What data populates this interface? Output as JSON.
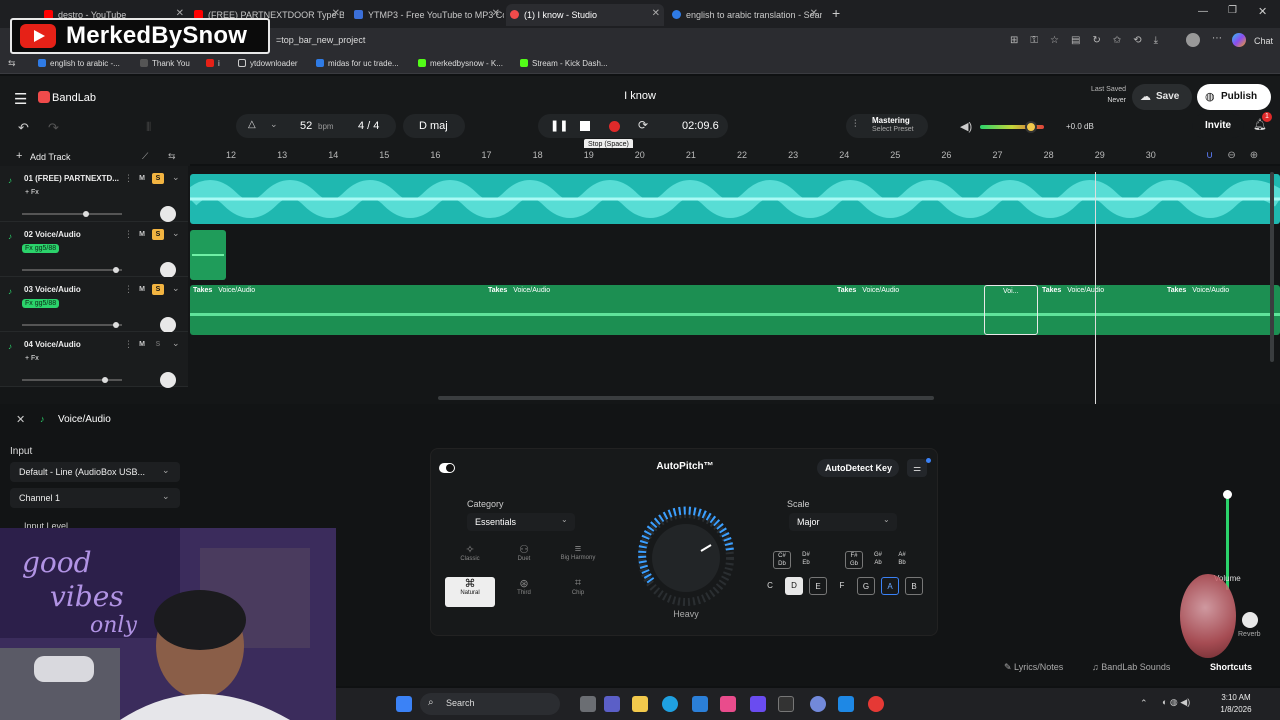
{
  "watermark": "MerkedBySnow",
  "browser": {
    "tabs": [
      {
        "title": "destro - YouTube",
        "color": "#ff0000"
      },
      {
        "title": "(FREE) PARTNEXTDOOR Type Beat",
        "color": "#ff0000"
      },
      {
        "title": "YTMP3 - Free YouTube to MP3 Co",
        "color": "#3b6fd8"
      },
      {
        "title": "(1) I know - Studio",
        "color": "#f04b4b"
      },
      {
        "title": "english to arabic translation - Sear",
        "color": "#2f7be5"
      }
    ],
    "url": "=top_bar_new_project",
    "bookmarks": [
      "english to arabic -...",
      "Thank You",
      "i",
      "ytdownloader",
      "midas for uc trade...",
      "merkedbysnow - K...",
      "Stream - Kick Dash..."
    ],
    "chat_label": "Chat"
  },
  "app": {
    "brand": "BandLab",
    "project_title": "I know",
    "last_saved_label": "Last Saved",
    "last_saved_value": "Never",
    "save_label": "Save",
    "publish_label": "Publish",
    "invite_label": "Invite",
    "notification_count": "1",
    "bpm_value": "52",
    "bpm_unit": "bpm",
    "time_sig": "4 / 4",
    "key": "D maj",
    "time": "02:09.6",
    "stop_tooltip": "Stop (Space)",
    "mastering_label": "Mastering",
    "mastering_sub": "Select Preset",
    "master_db": "+0.0 dB",
    "master_level": 0.8,
    "add_track": "Add Track",
    "ruler": [
      "12",
      "13",
      "14",
      "15",
      "16",
      "17",
      "18",
      "19",
      "20",
      "21",
      "22",
      "23",
      "24",
      "25",
      "26",
      "27",
      "28",
      "29",
      "30"
    ]
  },
  "tracks": [
    {
      "name": "01  (FREE) PARTNEXTD...",
      "fx": "+ Fx",
      "solo": true,
      "volume": 0.65
    },
    {
      "name": "02  Voice/Audio",
      "fx": "Fx gg5/88",
      "solo": true,
      "volume": 0.97
    },
    {
      "name": "03  Voice/Audio",
      "fx": "Fx gg5/88",
      "solo": true,
      "volume": 0.97
    },
    {
      "name": "04  Voice/Audio",
      "fx": "+ Fx",
      "solo": false,
      "volume": 0.85
    }
  ],
  "clip_labels": {
    "takes": "Takes",
    "voice": "Voice/Audio",
    "short": "Voi..."
  },
  "panel": {
    "title": "Voice/Audio",
    "input_label": "Input",
    "input_device": "Default - Line (AudioBox USB...",
    "channel": "Channel 1",
    "input_level_label": "Input Level",
    "volume_label": "Volume",
    "reverb_label": "Reverb",
    "lyrics_label": "Lyrics/Notes",
    "sounds_label": "BandLab Sounds",
    "shortcuts_label": "Shortcuts"
  },
  "autopitch": {
    "title": "AutoPitch™",
    "autodetect": "AutoDetect Key",
    "category_label": "Category",
    "category_value": "Essentials",
    "scale_label": "Scale",
    "scale_value": "Major",
    "dial_label": "Heavy",
    "modes": [
      "Classic",
      "Duet",
      "Big Harmony",
      "Natural",
      "Third",
      "Chip"
    ],
    "sharp_keys": [
      "C#\nDb",
      "D#\nEb",
      "F#\nGb",
      "G#\nAb",
      "A#\nBb"
    ],
    "keys": [
      "C",
      "D",
      "E",
      "F",
      "G",
      "A",
      "B"
    ]
  },
  "taskbar": {
    "search_label": "Search",
    "time": "3:10 AM",
    "date": "1/8/2026"
  }
}
